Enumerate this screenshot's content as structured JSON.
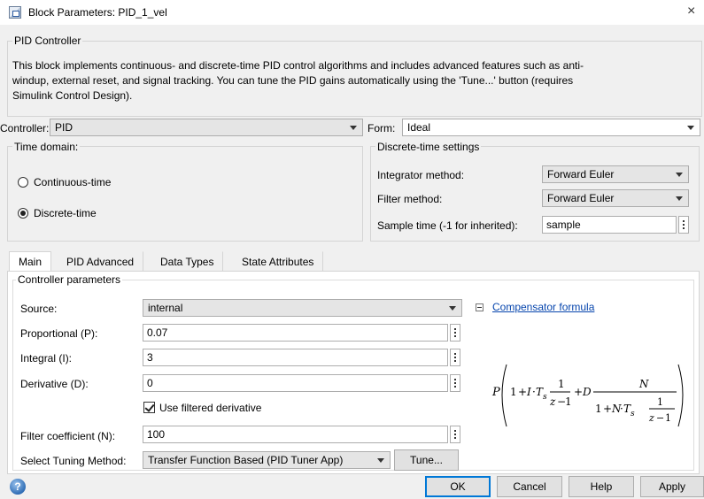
{
  "window": {
    "title": "Block Parameters: PID_1_vel",
    "close_glyph": "×"
  },
  "block": {
    "group_title": "PID Controller",
    "description_lines": [
      "This block implements continuous- and discrete-time PID control algorithms and includes advanced features such as anti-",
      "windup, external reset, and signal tracking. You can tune the PID gains automatically using the 'Tune...' button (requires",
      "Simulink Control Design)."
    ]
  },
  "controller": {
    "label": "Controller:",
    "value": "PID"
  },
  "form": {
    "label": "Form:",
    "value": "Ideal"
  },
  "time_domain": {
    "group_title": "Time domain:",
    "options": [
      {
        "label": "Continuous-time",
        "selected": false
      },
      {
        "label": "Discrete-time",
        "selected": true
      }
    ]
  },
  "discrete_settings": {
    "group_title": "Discrete-time settings",
    "integrator_label": "Integrator method:",
    "integrator_value": "Forward Euler",
    "filter_label": "Filter method:",
    "filter_value": "Forward Euler",
    "sample_label": "Sample time (-1 for inherited):",
    "sample_value": "sample"
  },
  "tabs": [
    {
      "label": "Main",
      "active": true
    },
    {
      "label": "PID Advanced",
      "active": false
    },
    {
      "label": "Data Types",
      "active": false
    },
    {
      "label": "State Attributes",
      "active": false
    }
  ],
  "controller_params": {
    "group_title": "Controller parameters",
    "source_label": "Source:",
    "source_value": "internal",
    "p_label": "Proportional (P):",
    "p_value": "0.07",
    "i_label": "Integral (I):",
    "i_value": "3",
    "d_label": "Derivative (D):",
    "d_value": "0",
    "filtered_label": "Use filtered derivative",
    "filtered_checked": true,
    "n_label": "Filter coefficient (N):",
    "n_value": "100",
    "tuning_label": "Select Tuning Method:",
    "tuning_value": "Transfer Function Based (PID Tuner App)",
    "tune_button": "Tune..."
  },
  "compensator": {
    "link_label": "Compensator formula",
    "formula": {
      "P": "P",
      "one": "1",
      "plus": "+",
      "I": "I",
      "dot": "·",
      "T": "T",
      "s": "s",
      "z": "z",
      "minus": "−",
      "D": "D",
      "N": "N"
    }
  },
  "footer": {
    "ok": "OK",
    "cancel": "Cancel",
    "help": "Help",
    "apply": "Apply",
    "help_icon_glyph": "?"
  }
}
